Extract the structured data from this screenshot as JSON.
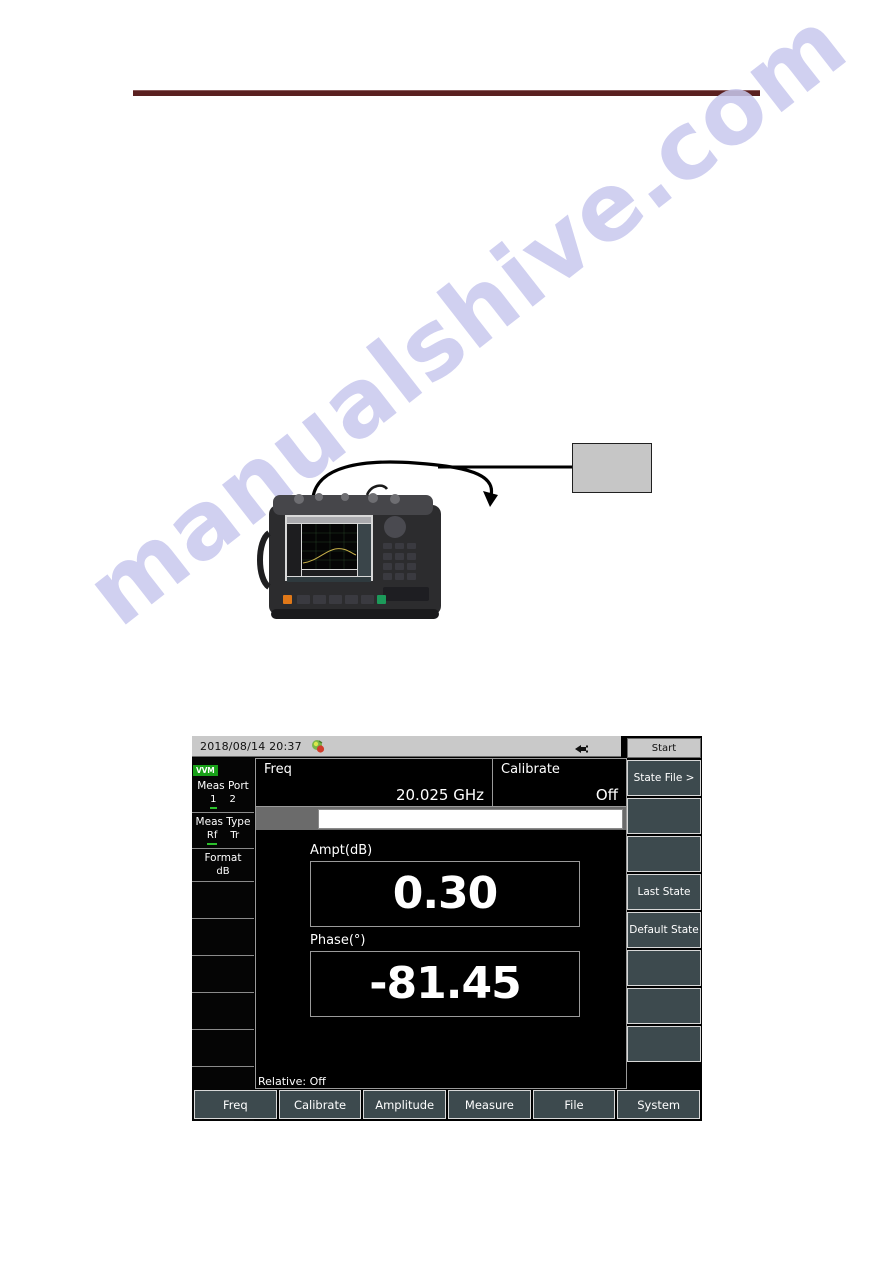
{
  "document": {
    "watermark": "manualshive.com"
  },
  "figure": {
    "callout_box_label": "",
    "device_alt": "handheld microwave analyzer"
  },
  "instrument": {
    "status_bar": {
      "datetime": "2018/08/14 20:37",
      "tray_icon": "app-tray-icon",
      "power_icon": "power-plug-icon"
    },
    "sidebar": {
      "mode_badge": "VVM",
      "cells": [
        {
          "title": "Meas Port",
          "options": [
            "1",
            "2"
          ],
          "active_index": 0
        },
        {
          "title": "Meas Type",
          "options": [
            "Rf",
            "Tr"
          ],
          "active_index": 0
        },
        {
          "title": "Format",
          "value": "dB"
        }
      ],
      "empty_cells": 6
    },
    "header": {
      "freq": {
        "label": "Freq",
        "value": "20.025 GHz"
      },
      "calibrate": {
        "label": "Calibrate",
        "value": "Off"
      }
    },
    "entry_field": {
      "value": "",
      "placeholder": ""
    },
    "readouts": [
      {
        "label": "Ampt(dB)",
        "value": "0.30"
      },
      {
        "label": "Phase(°)",
        "value": "-81.45"
      }
    ],
    "relative_status": "Relative:   Off",
    "right_keys": [
      {
        "label": "Start",
        "type": "header"
      },
      {
        "label": "State File >",
        "type": "key"
      },
      {
        "label": "",
        "type": "key"
      },
      {
        "label": "",
        "type": "key"
      },
      {
        "label": "Last State",
        "type": "key"
      },
      {
        "label": "Default State",
        "type": "key"
      },
      {
        "label": "",
        "type": "key"
      },
      {
        "label": "",
        "type": "key"
      },
      {
        "label": "",
        "type": "key"
      }
    ],
    "bottom_menu": [
      "Freq",
      "Calibrate",
      "Amplitude",
      "Measure",
      "File",
      "System"
    ]
  },
  "colors": {
    "accent_green": "#2bbf2b",
    "badge_green": "#18a018",
    "softkey_bg": "#3d4a4e",
    "status_bar_bg": "#c9c9c9",
    "rule_maroon": "#5a2020"
  }
}
